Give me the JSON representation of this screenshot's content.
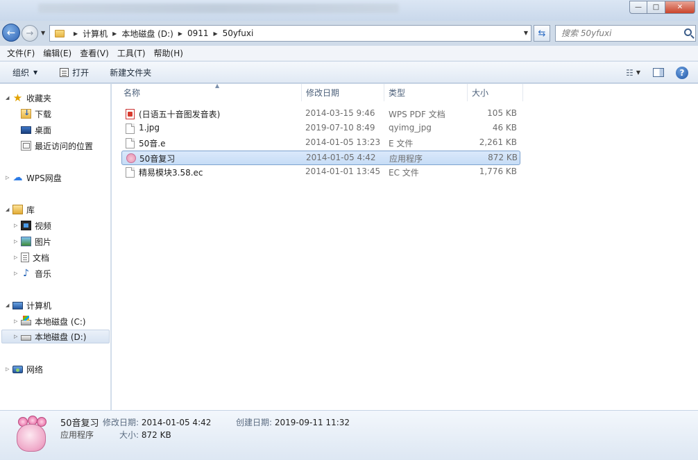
{
  "window": {
    "minimize_glyph": "—",
    "maximize_glyph": "□",
    "close_glyph": "✕"
  },
  "nav": {
    "breadcrumb": [
      "计算机",
      "本地磁盘 (D:)",
      "0911",
      "50yfuxi"
    ],
    "search_placeholder": "搜索 50yfuxi"
  },
  "menu": [
    "文件(F)",
    "编辑(E)",
    "查看(V)",
    "工具(T)",
    "帮助(H)"
  ],
  "toolbar": {
    "organize": "组织",
    "open": "打开",
    "new_folder": "新建文件夹"
  },
  "sidebar": {
    "favorites": "收藏夹",
    "downloads": "下载",
    "desktop": "桌面",
    "recent": "最近访问的位置",
    "wps": "WPS网盘",
    "libraries": "库",
    "videos": "视频",
    "pictures": "图片",
    "documents": "文档",
    "music": "音乐",
    "computer": "计算机",
    "drive_c": "本地磁盘 (C:)",
    "drive_d": "本地磁盘 (D:)",
    "network": "网络"
  },
  "columns": {
    "name": "名称",
    "date": "修改日期",
    "type": "类型",
    "size": "大小"
  },
  "files": [
    {
      "name": "(日语五十音图发音表)",
      "date": "2014-03-15 9:46",
      "type": "WPS PDF 文档",
      "size": "105 KB",
      "icon": "pdf-icon"
    },
    {
      "name": "1.jpg",
      "date": "2019-07-10 8:49",
      "type": "qyimg_jpg",
      "size": "46 KB",
      "icon": "blank-file-icon"
    },
    {
      "name": "50音.e",
      "date": "2014-01-05 13:23",
      "type": "E 文件",
      "size": "2,261 KB",
      "icon": "blank-file-icon"
    },
    {
      "name": "50音复习",
      "date": "2014-01-05 4:42",
      "type": "应用程序",
      "size": "872 KB",
      "icon": "app-icon"
    },
    {
      "name": "精易模块3.58.ec",
      "date": "2014-01-01 13:45",
      "type": "EC 文件",
      "size": "1,776 KB",
      "icon": "blank-file-icon"
    }
  ],
  "details": {
    "name": "50音复习",
    "type": "应用程序",
    "modified_label": "修改日期:",
    "modified": "2014-01-05 4:42",
    "created_label": "创建日期:",
    "created": "2019-09-11 11:32",
    "size_label": "大小:",
    "size": "872 KB"
  }
}
